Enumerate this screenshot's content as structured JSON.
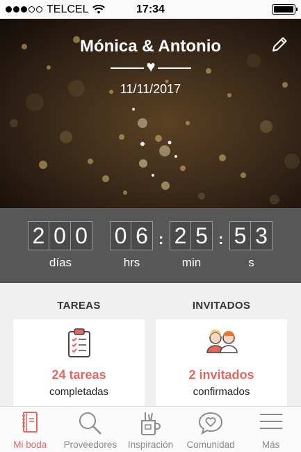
{
  "status_bar": {
    "carrier": "TELCEL",
    "time": "17:34"
  },
  "header": {
    "couple_names": "Mónica & Antonio",
    "date": "11/11/2017"
  },
  "countdown": {
    "days": "200",
    "hours": "06",
    "minutes": "25",
    "seconds": "53",
    "days_label": "días",
    "hours_label": "hrs",
    "minutes_label": "min",
    "seconds_label": "s"
  },
  "tasks": {
    "title": "TAREAS",
    "count": "24 tareas",
    "caption": "completadas"
  },
  "guests": {
    "title": "INVITADOS",
    "count": "2 invitados",
    "caption": "confirmados"
  },
  "tabbar": {
    "items": [
      {
        "label": "Mi boda",
        "icon": "book-icon"
      },
      {
        "label": "Proveedores",
        "icon": "search-icon"
      },
      {
        "label": "Inspiración",
        "icon": "brushes-icon"
      },
      {
        "label": "Comunidad",
        "icon": "heart-bubble-icon"
      },
      {
        "label": "Más",
        "icon": "menu-icon"
      }
    ]
  },
  "colors": {
    "accent": "#e5655f",
    "countdown_bg": "#575757"
  }
}
